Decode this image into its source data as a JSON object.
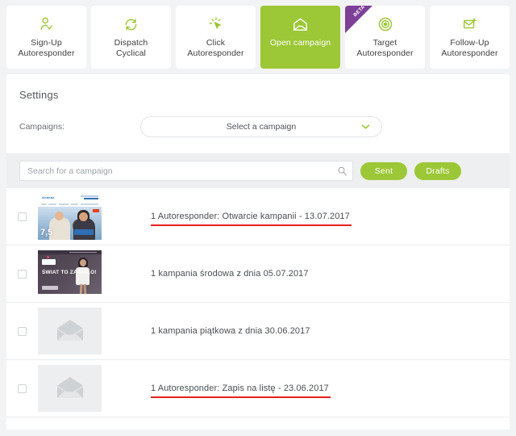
{
  "tabs": [
    {
      "label": "Sign-Up\nAutoresponder",
      "icon": "person-check-icon",
      "active": false,
      "beta": false
    },
    {
      "label": "Dispatch\nCyclical",
      "icon": "refresh-cycle-icon",
      "active": false,
      "beta": false
    },
    {
      "label": "Click\nAutoresponder",
      "icon": "click-cursor-icon",
      "active": false,
      "beta": false
    },
    {
      "label": "Open campaign",
      "icon": "open-envelope-icon",
      "active": true,
      "beta": false
    },
    {
      "label": "Target\nAutoresponder",
      "icon": "target-icon",
      "active": false,
      "beta": true,
      "beta_label": "BETA"
    },
    {
      "label": "Follow-Up\nAutoresponder",
      "icon": "envelope-plus-icon",
      "active": false,
      "beta": false
    }
  ],
  "settings": {
    "title": "Settings",
    "campaigns_label": "Campaigns:",
    "campaign_select_value": "Select a campaign"
  },
  "filterbar": {
    "search_placeholder": "Search for a campaign",
    "search_value": "",
    "search_icon": "search-icon",
    "sent_label": "Sent",
    "drafts_label": "Drafts"
  },
  "campaigns": [
    {
      "title": "1 Autoresponder: Otwarcie kampanii - 13.07.2017",
      "underlined": true,
      "thumb": "newsletter-ananas",
      "checked": false
    },
    {
      "title": "1 kampania środowa z dnia 05.07.2017",
      "underlined": false,
      "thumb": "newsletter-swiat",
      "checked": false
    },
    {
      "title": "1 kampania piątkowa z dnia 30.06.2017",
      "underlined": false,
      "thumb": "placeholder-envelope",
      "checked": false
    },
    {
      "title": "1 Autoresponder: Zapis na listę - 23.06.2017",
      "underlined": true,
      "thumb": "placeholder-envelope",
      "checked": false
    }
  ],
  "thumb_text": {
    "ananas_logo": "Ananas",
    "ananas_score": "7,5",
    "swiat_headline": "ŚWIAT\nTO ZA\nMAŁO!"
  },
  "colors": {
    "accent_green": "#9cc736",
    "beta_purple": "#7d3f98",
    "underline_red": "#e8201c",
    "page_bg": "#f2f3f5",
    "card_bg": "#ffffff",
    "filterbar_bg": "#eeeff1"
  }
}
